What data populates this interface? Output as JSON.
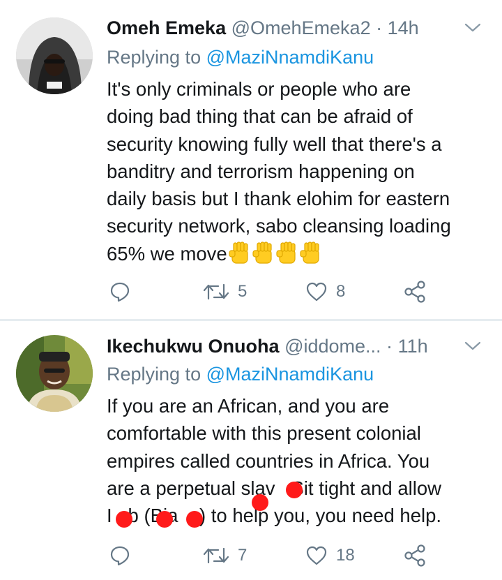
{
  "tweets": [
    {
      "author_name": "Omeh Emeka",
      "handle": "@OmehEmeka2",
      "dot": "·",
      "time": "14h",
      "replying_label": "Replying to",
      "replying_mention": "@MaziNnamdiKanu",
      "text_lines": [
        "It's only criminals or people who are",
        "doing bad thing that can be afraid of",
        "security knowing fully well that there's a",
        "banditry and terrorism happening on",
        "daily basis but I thank elohim for eastern",
        "security network, sabo cleansing loading",
        "65% we move"
      ],
      "emoji": "✊✊✊✊",
      "retweets": "5",
      "likes": "8",
      "icons": [
        "reply-icon",
        "retweet-icon",
        "heart-icon",
        "share-icon",
        "chevron-down-icon"
      ]
    },
    {
      "author_name": "Ikechukwu Onuoha",
      "handle": "@iddome...",
      "dot": "·",
      "time": "11h",
      "replying_label": "Replying to",
      "replying_mention": "@MaziNnamdiKanu",
      "text_lines": [
        "If you are an African, and you are",
        "comfortable with this present colonial",
        "empires called countries in Africa. You",
        "are a perpetual slav   Sit tight and allow",
        "I   b (Bia  a) to help you, you need help."
      ],
      "retweets": "7",
      "likes": "18",
      "icons": [
        "reply-icon",
        "retweet-icon",
        "heart-icon",
        "share-icon",
        "chevron-down-icon"
      ]
    }
  ],
  "colors": {
    "secondary": "#657786",
    "mention": "#1b95e0",
    "divider": "#e6ecf0",
    "annotation": "#ff1a1a"
  }
}
